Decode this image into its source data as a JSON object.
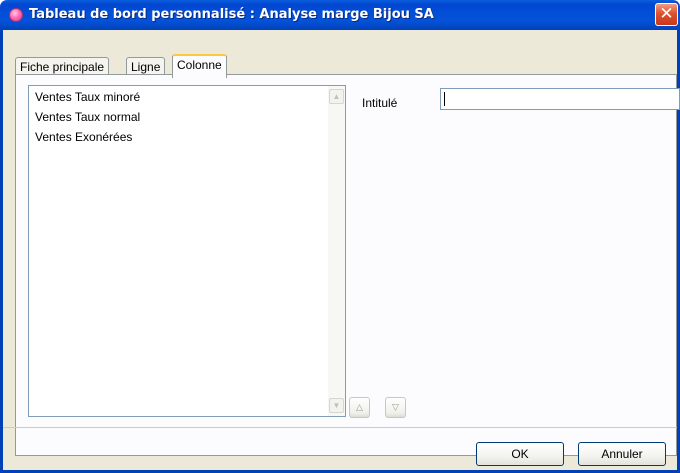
{
  "window": {
    "title": "Tableau de bord personnalisé : Analyse marge Bijou SA",
    "close_glyph": "✕"
  },
  "tabs": [
    {
      "label": "Fiche principale",
      "active": false
    },
    {
      "label": "Ligne",
      "active": false
    },
    {
      "label": "Colonne",
      "active": true
    }
  ],
  "columns_list": {
    "items": [
      "Ventes Taux minoré",
      "Ventes Taux normal",
      "Ventes Exonérées"
    ],
    "scroll_up_glyph": "▲",
    "scroll_down_glyph": "▼"
  },
  "form": {
    "intitule_label": "Intitulé",
    "intitule_value": ""
  },
  "order_buttons": {
    "up_glyph": "△",
    "down_glyph": "▽"
  },
  "footer": {
    "ok_label": "OK",
    "cancel_label": "Annuler"
  },
  "colors": {
    "titlebar": "#0350d8",
    "dialog_bg": "#ece9d8",
    "active_tab_highlight": "#ffc83c",
    "close_button": "#e0512f"
  },
  "icons": {
    "app": "pink-sphere-app-icon",
    "close": "close-icon",
    "move_up": "triangle-up-icon",
    "move_down": "triangle-down-icon"
  }
}
